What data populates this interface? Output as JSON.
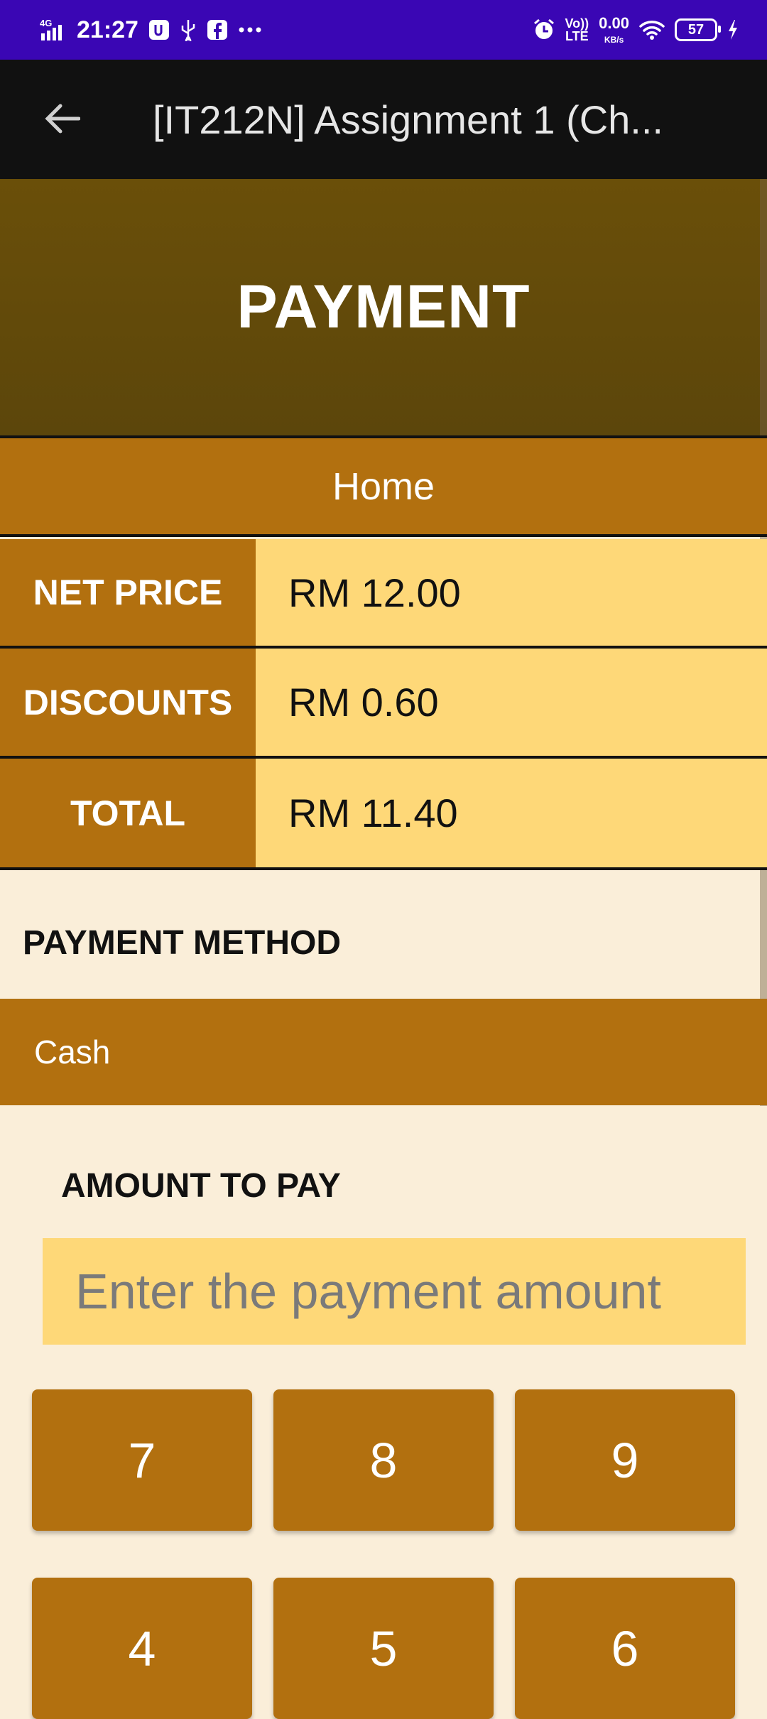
{
  "status_bar": {
    "network": "4G",
    "time": "21:27",
    "speed_value": "0.00",
    "speed_unit": "KB/s",
    "volte_top": "Vo))",
    "volte_bottom": "LTE",
    "battery": "57"
  },
  "app_bar": {
    "title": "[IT212N] Assignment 1 (Ch..."
  },
  "header": {
    "title": "PAYMENT"
  },
  "home_label": "Home",
  "summary": {
    "rows": [
      {
        "label": "NET PRICE",
        "value": "RM 12.00"
      },
      {
        "label": "DISCOUNTS",
        "value": "RM 0.60"
      },
      {
        "label": "TOTAL",
        "value": "RM 11.40"
      }
    ]
  },
  "payment_method": {
    "label": "PAYMENT METHOD",
    "selected": "Cash"
  },
  "amount": {
    "label": "AMOUNT TO PAY",
    "placeholder": "Enter the payment amount"
  },
  "keypad": {
    "keys": [
      "7",
      "8",
      "9",
      "4",
      "5",
      "6"
    ]
  },
  "colors": {
    "status_bar": "#3a06b4",
    "app_bar": "#111111",
    "header": "#6a4f09",
    "accent_brown": "#b2700f",
    "value_yellow": "#fed878",
    "background": "#faeed9"
  }
}
